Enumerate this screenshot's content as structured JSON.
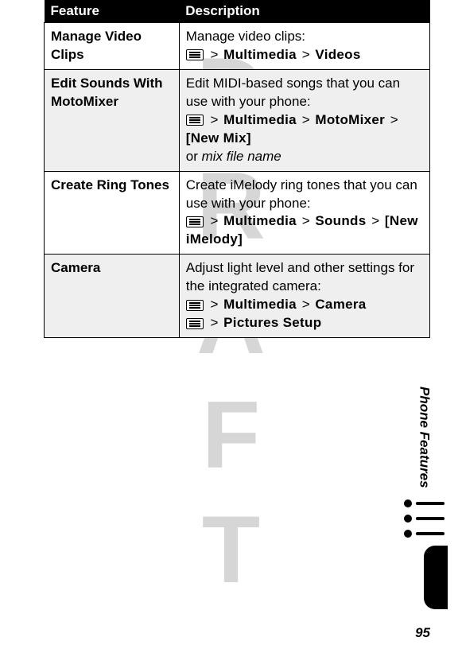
{
  "watermark": "DRAFT",
  "table": {
    "header": {
      "feature": "Feature",
      "description": "Description"
    },
    "rows": [
      {
        "feature": "Manage Video Clips",
        "lead": "Manage video clips:",
        "path1_a": "Multimedia",
        "path1_b": "Videos"
      },
      {
        "feature": "Edit Sounds With MotoMixer",
        "lead": "Edit MIDI-based songs that you can use with your phone:",
        "path1_a": "Multimedia",
        "path1_b": "MotoMixer",
        "path1_c": "[New Mix]",
        "tail_plain": "or ",
        "tail_italic": "mix file name"
      },
      {
        "feature": "Create Ring Tones",
        "lead": "Create iMelody ring tones that you can use with your phone:",
        "path1_a": "Multimedia",
        "path1_b": "Sounds",
        "path1_c": "[New iMelody]"
      },
      {
        "feature": "Camera",
        "lead": "Adjust light level and other settings for the integrated camera:",
        "path1_a": "Multimedia",
        "path1_b": "Camera",
        "path2_a": "Pictures Setup"
      }
    ]
  },
  "gt": ">",
  "side_label": "Phone Features",
  "page_number": "95"
}
